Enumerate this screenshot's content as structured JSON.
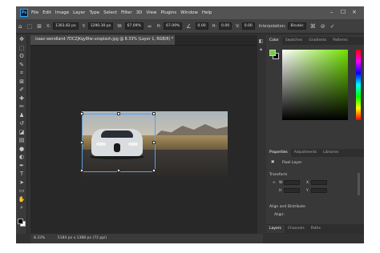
{
  "menubar": {
    "logo": "Ps",
    "items": [
      "File",
      "Edit",
      "Image",
      "Layer",
      "Type",
      "Select",
      "Filter",
      "3D",
      "View",
      "Plugins",
      "Window",
      "Help"
    ],
    "window_controls": [
      "–",
      "☐",
      "×"
    ]
  },
  "options_bar": {
    "x_label": "X:",
    "x_value": "1303.82 px",
    "y_label": "Y:",
    "y_value": "1290.30 px",
    "w_label": "W:",
    "w_value": "67.09%",
    "h_label": "H:",
    "h_value": "67.09%",
    "angle_value": "0.00",
    "h_skew_label": "H:",
    "h_skew_value": "0.00",
    "v_skew_label": "V:",
    "v_skew_value": "0.00",
    "interp_label": "Interpolation:",
    "interp_value": "Bicubic"
  },
  "document": {
    "tab_title": "isaac-wendland-7DCZjKqy8tw-unsplash.jpg @ 8.33% (Layer 1, RGB/8) *"
  },
  "status": {
    "zoom": "8.33%",
    "doc_size": "5184 px x 1388 px (72 ppi)"
  },
  "panels": {
    "color_tabs": [
      "Color",
      "Swatches",
      "Gradients",
      "Patterns"
    ],
    "properties_tabs": [
      "Properties",
      "Adjustments",
      "Libraries"
    ],
    "pixel_layer_label": "Pixel Layer",
    "transform_label": "Transform",
    "transform_fields": {
      "w": "W",
      "w_value": "",
      "h": "H",
      "h_value": "",
      "x": "X",
      "x_value": "",
      "y": "Y",
      "y_value": ""
    },
    "align_label": "Align and Distribute",
    "align_sub": "Align:",
    "layers_tabs": [
      "Layers",
      "Channels",
      "Paths"
    ],
    "colors": {
      "foreground": "#6fcf3f",
      "background": "#000000"
    }
  },
  "toolbar": {
    "icons": [
      "move-icon",
      "marquee-icon",
      "lasso-icon",
      "quick-select-icon",
      "crop-icon",
      "frame-icon",
      "eyedropper-icon",
      "healing-icon",
      "brush-icon",
      "stamp-icon",
      "history-brush-icon",
      "eraser-icon",
      "gradient-icon",
      "blur-icon",
      "dodge-icon",
      "pen-icon",
      "type-icon",
      "path-select-icon",
      "shape-icon",
      "hand-icon",
      "zoom-icon"
    ]
  }
}
